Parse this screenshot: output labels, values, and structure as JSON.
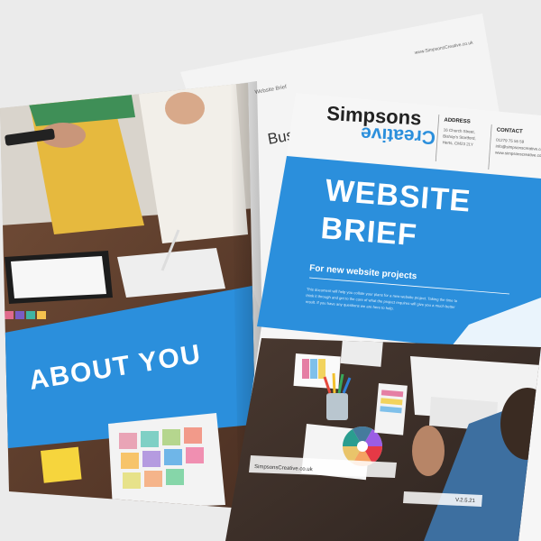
{
  "brochure_left": {
    "heading": "ABOUT YOU",
    "back_page_title": "Busi",
    "back_page_label": "Website Brief",
    "back_page_url": "www.SimpsonsCreative.co.uk"
  },
  "brochure_right": {
    "logo": {
      "line1": "Simpsons",
      "line2": "Creative"
    },
    "address_label": "ADDRESS",
    "address_lines": [
      "16 Church Street,",
      "Bishop's Stortford,",
      "Herts, CM23 2LY"
    ],
    "contact_label": "CONTACT",
    "contact_lines": [
      "01279 75 55 59",
      "info@simpsonscreative.co.uk",
      "www.simpsonscreative.co.uk"
    ],
    "title_line1": "WEBSITE",
    "title_line2": "BRIEF",
    "subtitle": "For new website projects",
    "intro_lines": [
      "This document will help you collate your plans for a new website project. Taking the time to",
      "think it through and get to the core of what the project requires will give you a much better",
      "result. If you have any questions we are here to help."
    ],
    "footer_url": "SimpsonsCreative.co.uk",
    "version": "V.2.5.21"
  },
  "colors": {
    "brand_blue": "#2b8fdc",
    "brand_blue_dark": "#1f6fba",
    "paper": "#f6f6f6",
    "background": "#ebebeb"
  }
}
